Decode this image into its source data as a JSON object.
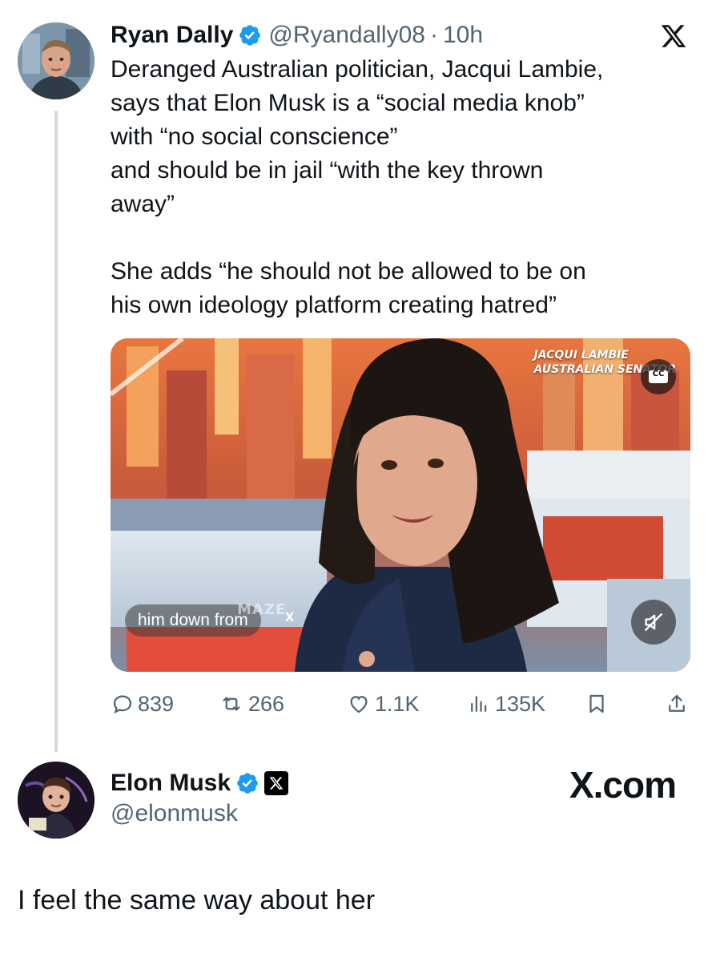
{
  "original_post": {
    "author_name": "Ryan Dally",
    "handle": "@Ryandally08",
    "separator": "·",
    "time": "10h",
    "lines": [
      "Deranged Australian politician, Jacqui Lambie,",
      "says that Elon Musk is a “social media knob”",
      "with “no social conscience”",
      "and should be in jail “with the key thrown",
      "away”"
    ],
    "lines2": [
      "She adds “he should not be allowed to be on",
      "his own ideology platform creating hatred”"
    ],
    "media": {
      "lower_third_line1": "JACQUI LAMBIE",
      "lower_third_line2": "AUSTRALIAN SENATOR",
      "cc_label": "CC",
      "caption": "him down from",
      "watermark": "MAZE",
      "caption_close": "x"
    },
    "stats": {
      "replies": "839",
      "reposts": "266",
      "likes": "1.1K",
      "views": "135K"
    }
  },
  "reply": {
    "author_name": "Elon Musk",
    "handle": "@elonmusk",
    "text": "I feel the same way about her",
    "site_label": "X.com"
  },
  "colors": {
    "text": "#0f1419",
    "secondary": "#536471",
    "verified": "#1d9bf0",
    "thread_line": "#cfd9de"
  },
  "icons": [
    "x-logo-icon",
    "verified-badge-icon",
    "reply-icon",
    "repost-icon",
    "like-icon",
    "views-icon",
    "bookmark-icon",
    "share-icon",
    "mute-icon",
    "cc-icon",
    "affiliate-x-icon"
  ]
}
